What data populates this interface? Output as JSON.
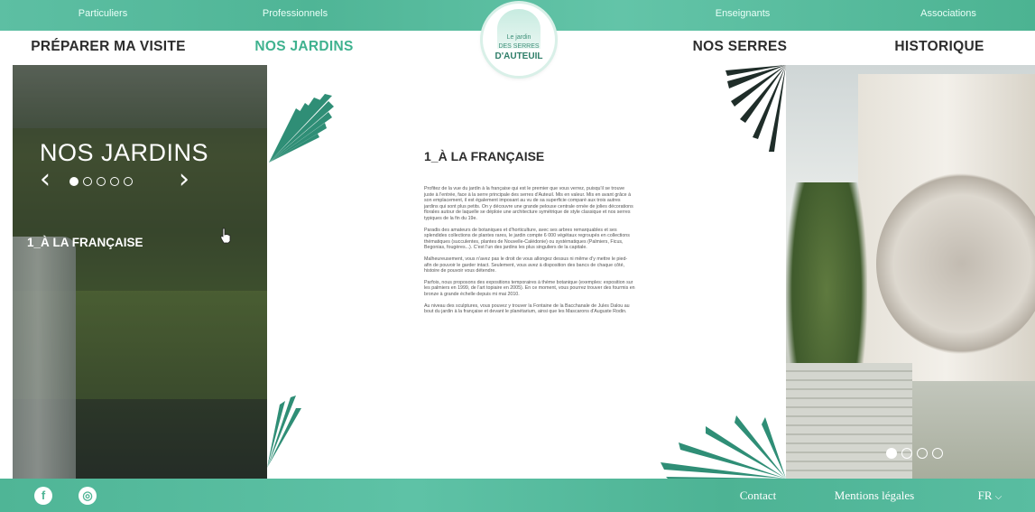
{
  "audience_bar": {
    "items": [
      "Particuliers",
      "Professionnels",
      "Enseignants",
      "Associations"
    ]
  },
  "nav": {
    "items": [
      "PRÉPARER MA VISITE",
      "NOS JARDINS",
      "NOS SERRES",
      "HISTORIQUE"
    ],
    "active": "NOS JARDINS"
  },
  "logo": {
    "line1": "Le jardin",
    "line2": "DES SERRES",
    "line3": "D'AUTEUIL"
  },
  "hero": {
    "title": "NOS JARDINS",
    "prev_icon": "chevron-left-icon",
    "next_icon": "chevron-right-icon",
    "slide_count": 5,
    "active_slide": 1,
    "current_item": "1_À LA FRANÇAISE"
  },
  "article": {
    "heading": "1_À LA FRANÇAISE",
    "paragraphs": [
      "Profitez de la vue du jardin à la française qui est le premier que vous verrez, puisqu'il se trouve juste à l'entrée, face à la serre principale des serres d'Auteuil. Mis en valeur. Mis en avant grâce à son emplacement, il est également imposant au vu de sa superficie comparé aux trois autres jardins qui sont plus petits. On y découvre une grande pelouse centrale ornée de jolies décorations florales autour de laquelle se déploie une architecture symétrique de style classique et nos serres typiques de la fin du 19e.",
      "Paradis des amateurs de botaniques et d'horticulture, avec ses arbres remarquables et ses splendides collections de plantes rares, le jardin compte 6 000 végétaux regroupés en collections thématiques (succulentes, plantes de Nouvelle-Calédonie) ou systématiques (Palmiers, Ficus, Begonias, fougères...). C'est l'un des jardins les plus singuliers de la capitale.",
      "Malheureusement, vous n'avez pas le droit de vous allongez dessus ni même d'y mettre le pied- afin de pouvoir le garder intact. Seulement, vous avez à disposition des bancs de chaque côté, histoire de pouvoir vous détendre.",
      "Parfois, nous proposons des expositions temporaires à thème botanique (exemples: exposition sur les palmiers en 1999, de l'art topiaire en 2005). En ce moment, vous pourrez trouver des fourmis en bronze à grande échelle depuis mi mai 2010.",
      "Au niveau des sculptures, vous pouvez y trouver la Fontaine de la Bacchanale de Jules Dalou au bout du jardin à la française et devant le planétarium, ainsi que les Mascarons d'Auguste Rodin."
    ]
  },
  "gallery": {
    "slide_count": 4,
    "active_slide": 1
  },
  "footer": {
    "social": [
      {
        "icon": "facebook-icon",
        "glyph": "f"
      },
      {
        "icon": "instagram-icon",
        "glyph": "◎"
      }
    ],
    "contact": "Contact",
    "legal": "Mentions légales",
    "language": "FR",
    "language_icon": "chevron-down-icon"
  },
  "colors": {
    "brand": "#4fb596",
    "active_nav": "#3fb28f",
    "text_dark": "#2d2d2d"
  }
}
